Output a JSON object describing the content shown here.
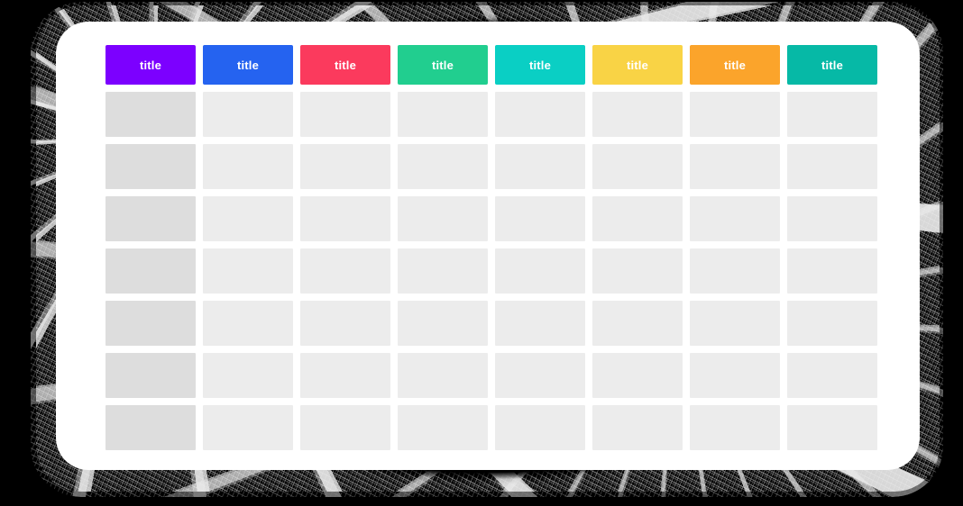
{
  "canvas": {
    "background_color": "#000000",
    "card_background_color": "#ffffff"
  },
  "table": {
    "column_count": 8,
    "body_row_count": 7,
    "header_label": "title",
    "columns": [
      {
        "index": 1,
        "header_label": "title",
        "header_color": "#7C00FF",
        "cell_color": "#DDDDDD"
      },
      {
        "index": 2,
        "header_label": "title",
        "header_color": "#2563F0",
        "cell_color": "#ECECEC"
      },
      {
        "index": 3,
        "header_label": "title",
        "header_color": "#FB3A5D",
        "cell_color": "#ECECEC"
      },
      {
        "index": 4,
        "header_label": "title",
        "header_color": "#21CE8F",
        "cell_color": "#ECECEC"
      },
      {
        "index": 5,
        "header_label": "title",
        "header_color": "#0ACFC4",
        "cell_color": "#ECECEC"
      },
      {
        "index": 6,
        "header_label": "title",
        "header_color": "#F9D345",
        "cell_color": "#ECECEC"
      },
      {
        "index": 7,
        "header_label": "title",
        "header_color": "#FBA42B",
        "cell_color": "#ECECEC"
      },
      {
        "index": 8,
        "header_label": "title",
        "header_color": "#06B9A6",
        "cell_color": "#ECECEC"
      }
    ],
    "rows": [
      {
        "row_index": 1,
        "cells": [
          "",
          "",
          "",
          "",
          "",
          "",
          "",
          ""
        ]
      },
      {
        "row_index": 2,
        "cells": [
          "",
          "",
          "",
          "",
          "",
          "",
          "",
          ""
        ]
      },
      {
        "row_index": 3,
        "cells": [
          "",
          "",
          "",
          "",
          "",
          "",
          "",
          ""
        ]
      },
      {
        "row_index": 4,
        "cells": [
          "",
          "",
          "",
          "",
          "",
          "",
          "",
          ""
        ]
      },
      {
        "row_index": 5,
        "cells": [
          "",
          "",
          "",
          "",
          "",
          "",
          "",
          ""
        ]
      },
      {
        "row_index": 6,
        "cells": [
          "",
          "",
          "",
          "",
          "",
          "",
          "",
          ""
        ]
      },
      {
        "row_index": 7,
        "cells": [
          "",
          "",
          "",
          "",
          "",
          "",
          "",
          ""
        ]
      }
    ]
  }
}
